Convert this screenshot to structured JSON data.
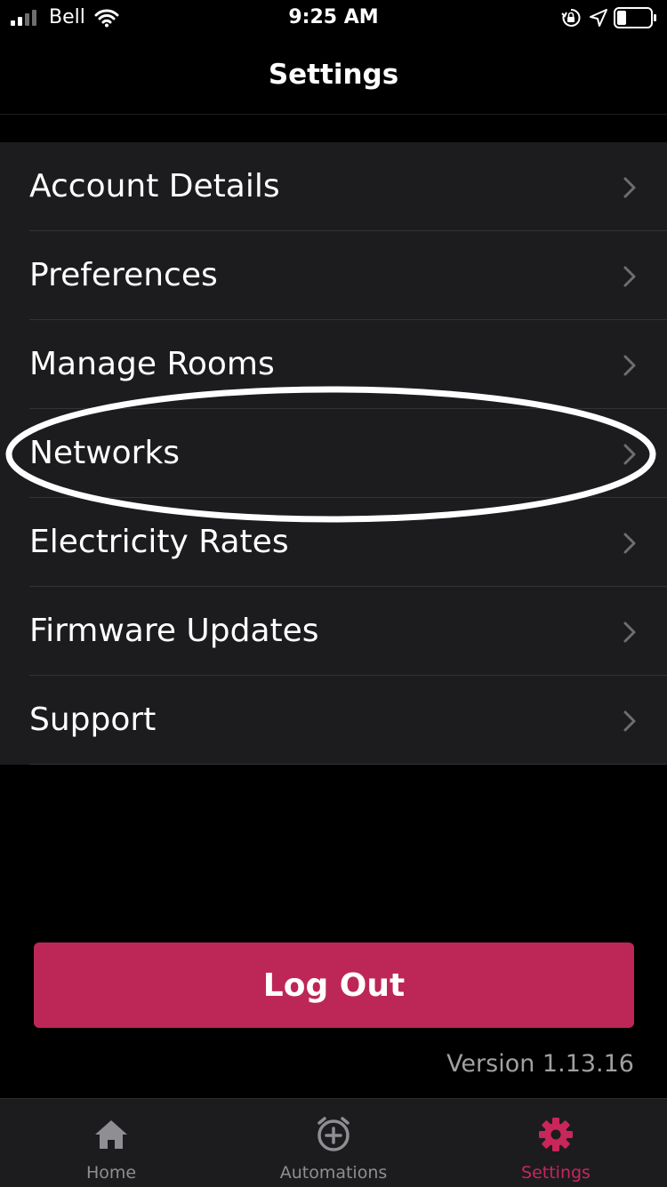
{
  "status_bar": {
    "carrier": "Bell",
    "time": "9:25 AM"
  },
  "header": {
    "title": "Settings"
  },
  "settings": {
    "items": [
      {
        "label": "Account Details"
      },
      {
        "label": "Preferences"
      },
      {
        "label": "Manage Rooms"
      },
      {
        "label": "Networks",
        "highlighted": true
      },
      {
        "label": "Electricity Rates"
      },
      {
        "label": "Firmware Updates"
      },
      {
        "label": "Support"
      }
    ]
  },
  "logout": {
    "label": "Log Out"
  },
  "version": "Version 1.13.16",
  "tab_bar": {
    "tabs": [
      {
        "label": "Home",
        "icon": "home-icon",
        "active": false
      },
      {
        "label": "Automations",
        "icon": "alarm-add-icon",
        "active": false
      },
      {
        "label": "Settings",
        "icon": "gear-icon",
        "active": true
      }
    ]
  },
  "colors": {
    "accent": "#bd2757",
    "active_tab": "#c9265b",
    "inactive_tab": "#8e8e93",
    "list_background": "#1c1c1e",
    "page_background": "#000000"
  }
}
